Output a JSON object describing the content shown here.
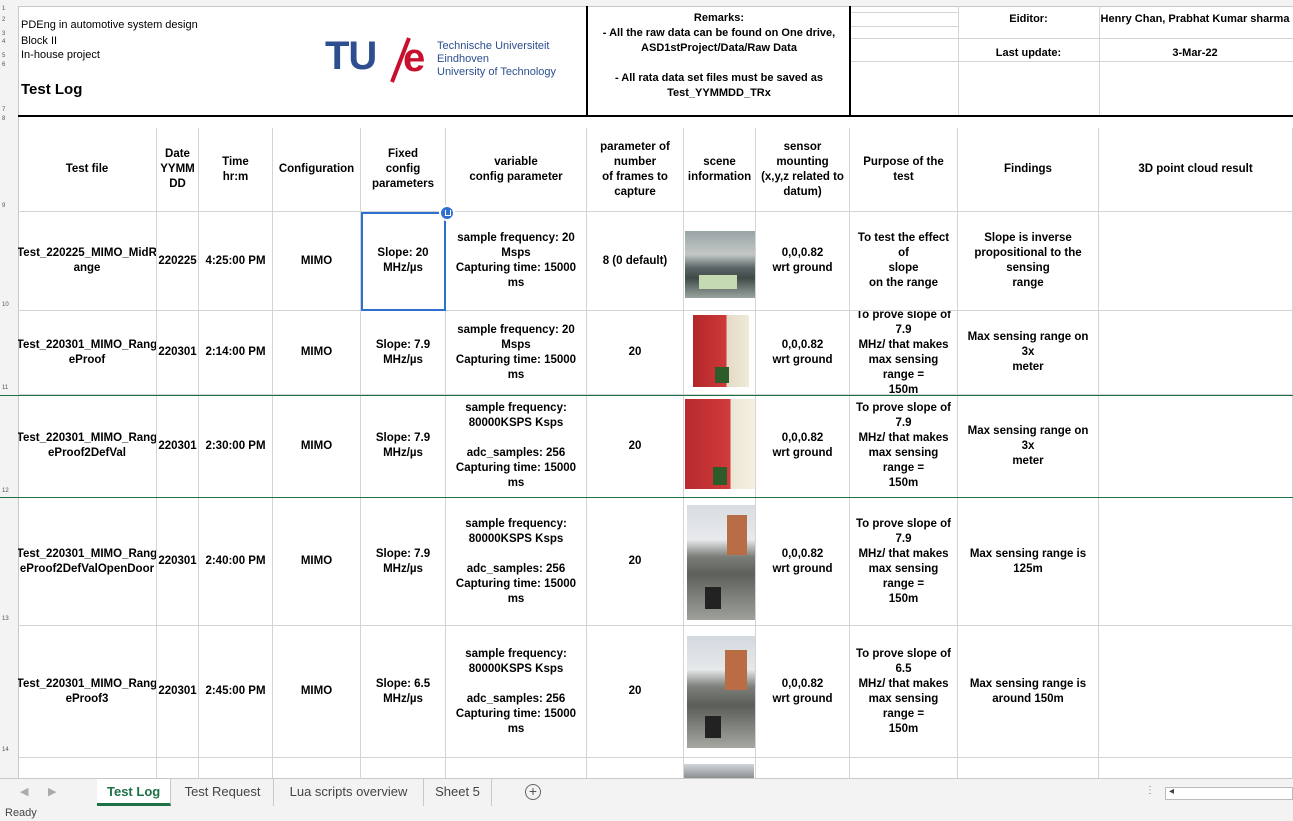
{
  "header": {
    "lines": [
      "PDEng in automotive system design",
      "Block II",
      "In-house project"
    ],
    "title": "Test Log",
    "logo": {
      "mark_tu": "TU",
      "mark_e": "e",
      "line1": "Technische Universiteit",
      "line2": "Eindhoven",
      "line3": "University of Technology"
    },
    "remarks_title": "Remarks:",
    "remarks_1": "- All the raw data can be found on One drive,",
    "remarks_2": "ASD1stProject/Data/Raw Data",
    "remarks_3": "- All rata data set files must be saved as",
    "remarks_4": "Test_YYMMDD_TRx",
    "editor_label": "Eiditor:",
    "editor_value": "Henry Chan, Prabhat Kumar sharma",
    "update_label": "Last update:",
    "update_value": "3-Mar-22"
  },
  "columns": [
    "Test file",
    "Date\nYYMM\nDD",
    "Time\nhr:m",
    "Configuration",
    "Fixed\nconfig\nparameters",
    "variable\nconfig parameter",
    "parameter of\nnumber\nof frames to\ncapture",
    "scene\ninformation",
    "sensor\nmounting\n(x,y,z related to\ndatum)",
    "Purpose of the\ntest",
    "Findings",
    "3D point cloud result"
  ],
  "rows": [
    {
      "file": "Test_220225_MIMO_MidR\nange",
      "date": "220225",
      "time": "4:25:00 PM",
      "config": "MIMO",
      "fixed": "Slope: 20\nMHz/µs",
      "variable": "sample frequency: 20 Msps\nCapturing time: 15000 ms",
      "frames": "8 (0 default)",
      "scene": "photo-parking-lot",
      "mounting": "0,0,0.82\nwrt ground",
      "purpose": "To test the effect of\nslope\non the range",
      "findings": "Slope is inverse\npropositional to the sensing\nrange",
      "cloud": ""
    },
    {
      "file": "Test_220301_MIMO_Rang\neProof",
      "date": "220301",
      "time": "2:14:00 PM",
      "config": "MIMO",
      "fixed": "Slope: 7.9\nMHz/µs",
      "variable": "sample frequency: 20 Msps\nCapturing time: 15000 ms",
      "frames": "20",
      "scene": "photo-red-door",
      "mounting": "0,0,0.82\nwrt ground",
      "purpose": "To prove slope of 7.9\nMHz/ that makes\nmax sensing range =\n150m",
      "findings": "Max sensing range on 3x\nmeter",
      "cloud": ""
    },
    {
      "file": "Test_220301_MIMO_Rang\neProof2DefVal",
      "date": "220301",
      "time": "2:30:00 PM",
      "config": "MIMO",
      "fixed": "Slope: 7.9\nMHz/µs",
      "variable": "sample frequency:\n80000KSPS Ksps\n\nadc_samples: 256\nCapturing time: 15000 ms",
      "frames": "20",
      "scene": "photo-red-door",
      "mounting": "0,0,0.82\nwrt ground",
      "purpose": "To prove slope of 7.9\nMHz/ that makes\nmax sensing range =\n150m",
      "findings": "Max sensing range on 3x\nmeter",
      "cloud": ""
    },
    {
      "file": "Test_220301_MIMO_Rang\neProof2DefValOpenDoor",
      "date": "220301",
      "time": "2:40:00 PM",
      "config": "MIMO",
      "fixed": "Slope: 7.9\nMHz/µs",
      "variable": "sample frequency:\n80000KSPS Ksps\n\nadc_samples: 256\nCapturing time: 15000 ms",
      "frames": "20",
      "scene": "photo-outdoor-building",
      "mounting": "0,0,0.82\nwrt ground",
      "purpose": "To prove slope of 7.9\nMHz/ that makes\nmax sensing range =\n150m",
      "findings": "Max sensing range is 125m",
      "cloud": ""
    },
    {
      "file": "Test_220301_MIMO_Rang\neProof3",
      "date": "220301",
      "time": "2:45:00 PM",
      "config": "MIMO",
      "fixed": "Slope: 6.5\nMHz/µs",
      "variable": "sample frequency:\n80000KSPS Ksps\n\nadc_samples: 256\nCapturing time: 15000 ms",
      "frames": "20",
      "scene": "photo-outdoor-building",
      "mounting": "0,0,0.82\nwrt ground",
      "purpose": "To prove slope of 6.5\nMHz/ that makes\nmax sensing range =\n150m",
      "findings": "Max sensing range is\naround 150m",
      "cloud": ""
    }
  ],
  "row_numbers": [
    "1",
    "2",
    "3",
    "4",
    "5",
    "6",
    "7",
    "8",
    "9",
    "10",
    "11",
    "12",
    "13",
    "14"
  ],
  "tabs": [
    "Test Log",
    "Test Request",
    "Lua scripts overview",
    "Sheet 5"
  ],
  "status": "Ready",
  "colors": {
    "accent": "#1e7145",
    "selection": "#2f6fce",
    "logo_red": "#c8102e",
    "logo_blue": "#2d4f8f"
  }
}
